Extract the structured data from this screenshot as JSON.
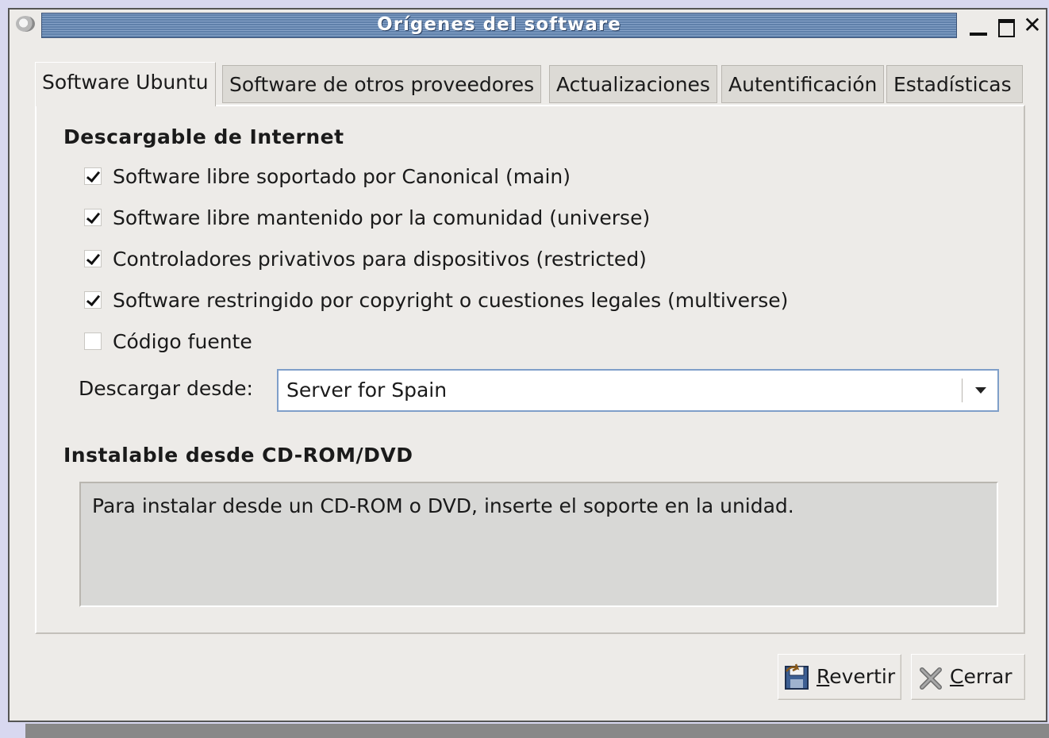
{
  "window": {
    "title": "Orígenes del software"
  },
  "tabs": [
    {
      "label": "Software Ubuntu",
      "active": true
    },
    {
      "label": "Software de otros proveedores",
      "active": false
    },
    {
      "label": "Actualizaciones",
      "active": false
    },
    {
      "label": "Autentificación",
      "active": false
    },
    {
      "label": "Estadísticas",
      "active": false
    }
  ],
  "internet_section": {
    "title": "Descargable de Internet",
    "options": [
      {
        "label": "Software libre soportado por Canonical (main)",
        "checked": true
      },
      {
        "label": "Software libre mantenido por la comunidad (universe)",
        "checked": true
      },
      {
        "label": "Controladores privativos para dispositivos (restricted)",
        "checked": true
      },
      {
        "label": "Software restringido por copyright o cuestiones legales (multiverse)",
        "checked": true
      },
      {
        "label": "Código fuente",
        "checked": false
      }
    ],
    "download_from_label": "Descargar desde:",
    "download_from_value": "Server for Spain"
  },
  "cdrom_section": {
    "title": "Instalable desde CD-ROM/DVD",
    "message": "Para instalar desde un CD-ROM o DVD, inserte el soporte en la unidad."
  },
  "buttons": {
    "revert_mnemonic": "R",
    "revert_rest": "evertir",
    "close_mnemonic": "C",
    "close_rest": "errar"
  },
  "colors": {
    "titlebar": "#6f8fb7",
    "window_bg": "#edebe8",
    "combo_border": "#7f9fc9"
  },
  "icons": {
    "window": "app-icon",
    "minimize": "minimize-icon",
    "maximize": "maximize-icon",
    "close": "close-icon",
    "revert": "revert-icon",
    "cancel": "cancel-icon",
    "dropdown": "chevron-down-icon",
    "check": "checkmark-icon"
  }
}
